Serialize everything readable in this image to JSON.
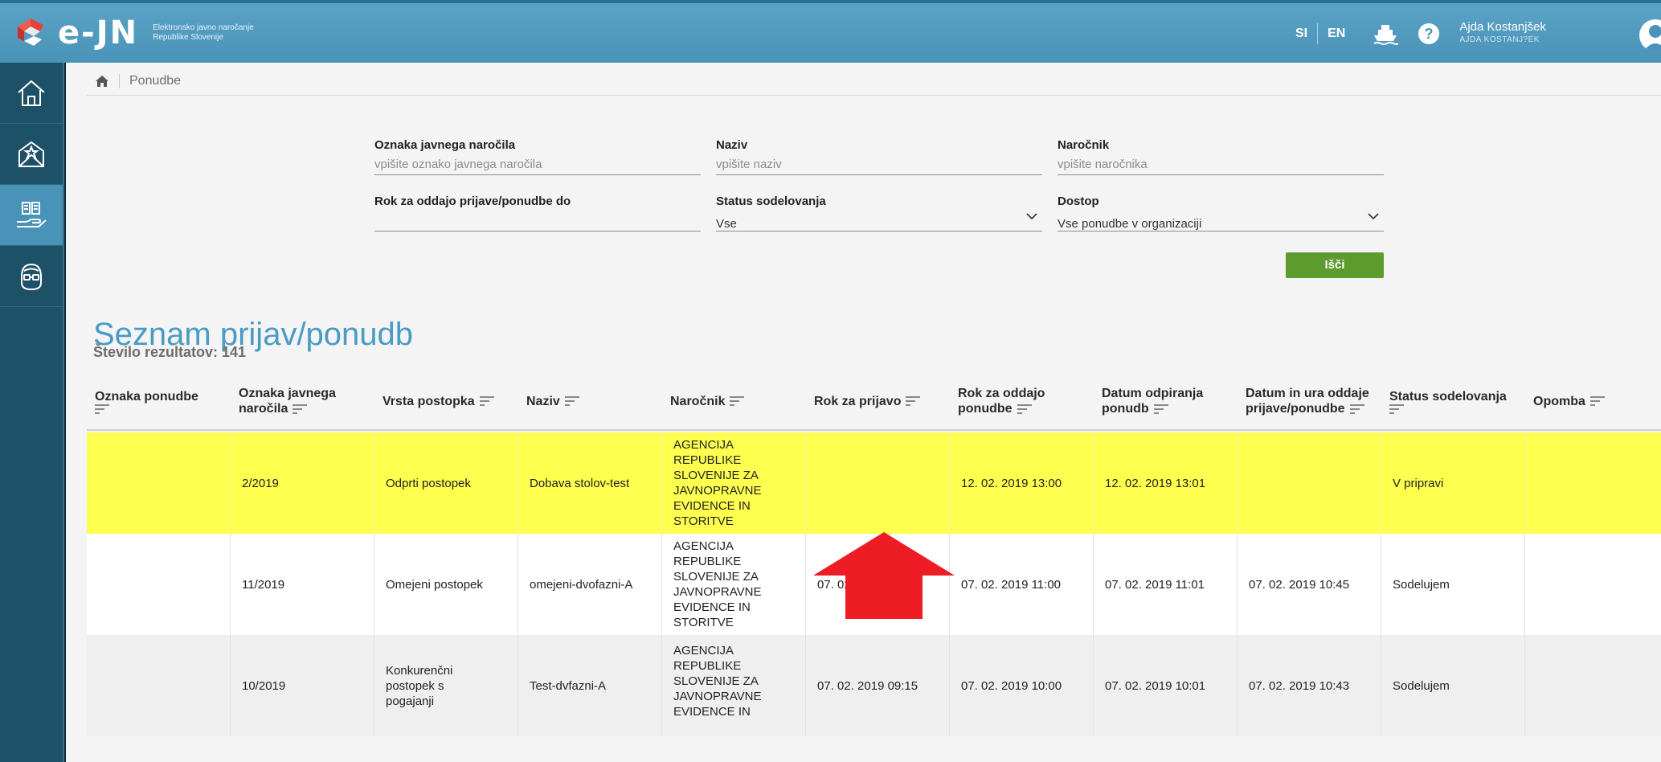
{
  "header": {
    "brand": "e-JN",
    "brand_sub_1": "Elektronsko javno naročanje",
    "brand_sub_2": "Republike Slovenije",
    "lang_si": "SI",
    "lang_en": "EN",
    "user_name": "Ajda Kostanjšek",
    "user_sub": "AJDA KOSTANJ?EK"
  },
  "sidebar": {
    "items": [
      {
        "icon": "home-icon"
      },
      {
        "icon": "envelope-star-icon"
      },
      {
        "icon": "hand-documents-icon"
      },
      {
        "icon": "glasses-face-icon"
      }
    ]
  },
  "breadcrumb": {
    "current": "Ponudbe"
  },
  "filters": {
    "oznaka_label": "Oznaka javnega naročila",
    "oznaka_placeholder": "vpišite oznako javnega naročila",
    "naziv_label": "Naziv",
    "naziv_placeholder": "vpišite naziv",
    "narocnik_label": "Naročnik",
    "narocnik_placeholder": "vpišite naročnika",
    "rok_label": "Rok za oddajo prijave/ponudbe do",
    "status_label": "Status sodelovanja",
    "status_value": "Vse",
    "dostop_label": "Dostop",
    "dostop_value": "Vse ponudbe v organizaciji",
    "search_label": "Išči"
  },
  "list": {
    "title": "Seznam prijav/ponudb",
    "count": "Število rezultatov: 141"
  },
  "table": {
    "headers": [
      "Oznaka ponudbe",
      "Oznaka javnega naročila",
      "Vrsta postopka",
      "Naziv",
      "Naročnik",
      "Rok za prijavo",
      "Rok za oddajo ponudbe",
      "Datum odpiranja ponudb",
      "Datum in ura oddaje prijave/ponudbe",
      "Status sodelovanja",
      "Opomba"
    ],
    "rows": [
      [
        "",
        "2/2019",
        "Odprti postopek",
        "Dobava stolov-test",
        "AGENCIJA REPUBLIKE SLOVENIJE ZA JAVNOPRAVNE EVIDENCE IN STORITVE",
        "",
        "12. 02. 2019 13:00",
        "12. 02. 2019 13:01",
        "",
        "V pripravi",
        ""
      ],
      [
        "",
        "11/2019",
        "Omejeni postopek",
        "omejeni-dvofazni-A",
        "AGENCIJA REPUBLIKE SLOVENIJE ZA JAVNOPRAVNE EVIDENCE IN STORITVE",
        "07. 02. 2019 10:40",
        "07. 02. 2019 11:00",
        "07. 02. 2019 11:01",
        "07. 02. 2019 10:45",
        "Sodelujem",
        ""
      ],
      [
        "",
        "10/2019",
        "Konkurenčni postopek s pogajanji",
        "Test-dvfazni-A",
        "AGENCIJA REPUBLIKE SLOVENIJE ZA JAVNOPRAVNE EVIDENCE IN",
        "07. 02. 2019 09:15",
        "07. 02. 2019 10:00",
        "07. 02. 2019 10:01",
        "07. 02. 2019 10:43",
        "Sodelujem",
        ""
      ]
    ]
  },
  "colors": {
    "header_blue": "#4a93b8",
    "highlight_yellow": "#ffff4f",
    "search_green": "#5e9b2d",
    "arrow_red": "#ee1c25"
  }
}
